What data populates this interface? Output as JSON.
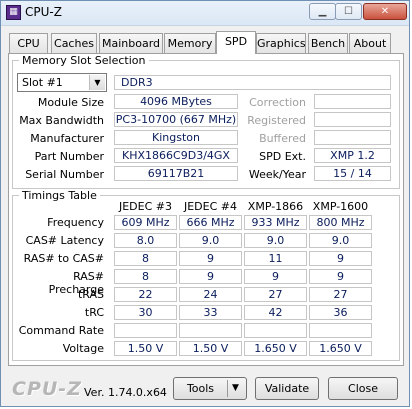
{
  "window": {
    "title": "CPU-Z"
  },
  "tabs": [
    {
      "label": "CPU"
    },
    {
      "label": "Caches"
    },
    {
      "label": "Mainboard"
    },
    {
      "label": "Memory"
    },
    {
      "label": "SPD",
      "active": true
    },
    {
      "label": "Graphics"
    },
    {
      "label": "Bench"
    },
    {
      "label": "About"
    }
  ],
  "slot": {
    "group_title": "Memory Slot Selection",
    "selected": "Slot #1",
    "type": "DDR3",
    "labels": {
      "module_size": "Module Size",
      "max_bandwidth": "Max Bandwidth",
      "manufacturer": "Manufacturer",
      "part_number": "Part Number",
      "serial_number": "Serial Number",
      "correction": "Correction",
      "registered": "Registered",
      "buffered": "Buffered",
      "spd_ext": "SPD Ext.",
      "week_year": "Week/Year"
    },
    "values": {
      "module_size": "4096 MBytes",
      "max_bandwidth": "PC3-10700 (667 MHz)",
      "manufacturer": "Kingston",
      "part_number": "KHX1866C9D3/4GX",
      "serial_number": "69117B21",
      "correction": "",
      "registered": "",
      "buffered": "",
      "spd_ext": "XMP 1.2",
      "week_year": "15 / 14"
    }
  },
  "timings": {
    "group_title": "Timings Table",
    "columns": [
      "JEDEC #3",
      "JEDEC #4",
      "XMP-1866",
      "XMP-1600"
    ],
    "rows": [
      {
        "label": "Frequency",
        "values": [
          "609 MHz",
          "666 MHz",
          "933 MHz",
          "800 MHz"
        ]
      },
      {
        "label": "CAS# Latency",
        "values": [
          "8.0",
          "9.0",
          "9.0",
          "9.0"
        ]
      },
      {
        "label": "RAS# to CAS#",
        "values": [
          "8",
          "9",
          "11",
          "9"
        ]
      },
      {
        "label": "RAS# Precharge",
        "values": [
          "8",
          "9",
          "9",
          "9"
        ]
      },
      {
        "label": "tRAS",
        "values": [
          "22",
          "24",
          "27",
          "27"
        ]
      },
      {
        "label": "tRC",
        "values": [
          "30",
          "33",
          "42",
          "36"
        ]
      },
      {
        "label": "Command Rate",
        "values": [
          "",
          "",
          "",
          ""
        ]
      },
      {
        "label": "Voltage",
        "values": [
          "1.50 V",
          "1.50 V",
          "1.650 V",
          "1.650 V"
        ]
      }
    ]
  },
  "footer": {
    "logo": "CPU-Z",
    "version": "Ver. 1.74.0.x64",
    "tools_label": "Tools",
    "validate_label": "Validate",
    "close_label": "Close"
  }
}
